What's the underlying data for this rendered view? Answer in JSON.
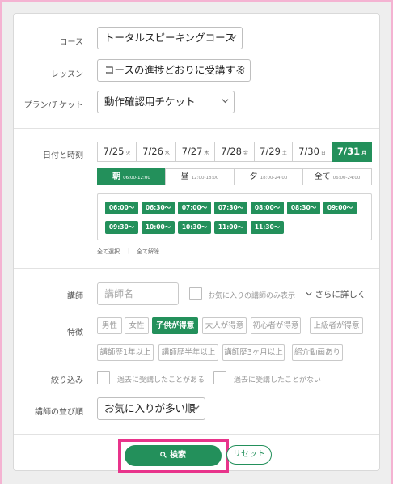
{
  "form": {
    "course_label": "コース",
    "course_value": "トータルスピーキングコース",
    "lesson_label": "レッスン",
    "lesson_value": "コースの進捗どおりに受講する",
    "plan_label": "プラン/チケット",
    "plan_value": "動作確認用チケット"
  },
  "schedule": {
    "label": "日付と時刻",
    "dates": [
      {
        "date": "7/25",
        "day": "火"
      },
      {
        "date": "7/26",
        "day": "水"
      },
      {
        "date": "7/27",
        "day": "木"
      },
      {
        "date": "7/28",
        "day": "金"
      },
      {
        "date": "7/29",
        "day": "土"
      },
      {
        "date": "7/30",
        "day": "日"
      },
      {
        "date": "7/31",
        "day": "月"
      }
    ],
    "active_date_index": 6,
    "times_of_day": [
      {
        "name": "朝",
        "range": "06:00-12:00"
      },
      {
        "name": "昼",
        "range": "12:00-18:00"
      },
      {
        "name": "夕",
        "range": "18:00-24:00"
      },
      {
        "name": "全て",
        "range": "06:00-24:00"
      }
    ],
    "active_tod_index": 0,
    "slots": [
      "06:00〜",
      "06:30〜",
      "07:00〜",
      "07:30〜",
      "08:00〜",
      "08:30〜",
      "09:00〜",
      "09:30〜",
      "10:00〜",
      "10:30〜",
      "11:00〜",
      "11:30〜"
    ],
    "select_all": "全て選択",
    "separator": "|",
    "deselect_all": "全て解除"
  },
  "teacher": {
    "label": "講師",
    "name_placeholder": "講師名",
    "favorites_only": "お気に入りの講師のみ表示",
    "more_link": "さらに詳しく"
  },
  "features": {
    "label": "特徴",
    "items": [
      "男性",
      "女性",
      "子供が得意",
      "大人が得意",
      "初心者が得意",
      "上級者が得意",
      "講師歴1年以上",
      "講師歴半年以上",
      "講師歴3ヶ月以上",
      "紹介動画あり"
    ],
    "active_index": 2
  },
  "filter": {
    "label": "絞り込み",
    "taken_before": "過去に受講したことがある",
    "never_taken": "過去に受講したことがない"
  },
  "sort": {
    "label": "講師の並び順",
    "value": "お気に入りが多い順"
  },
  "actions": {
    "search_label": "検索",
    "reset_label": "リセット"
  },
  "colors": {
    "accent": "#23905b",
    "highlight": "#e8348b"
  }
}
